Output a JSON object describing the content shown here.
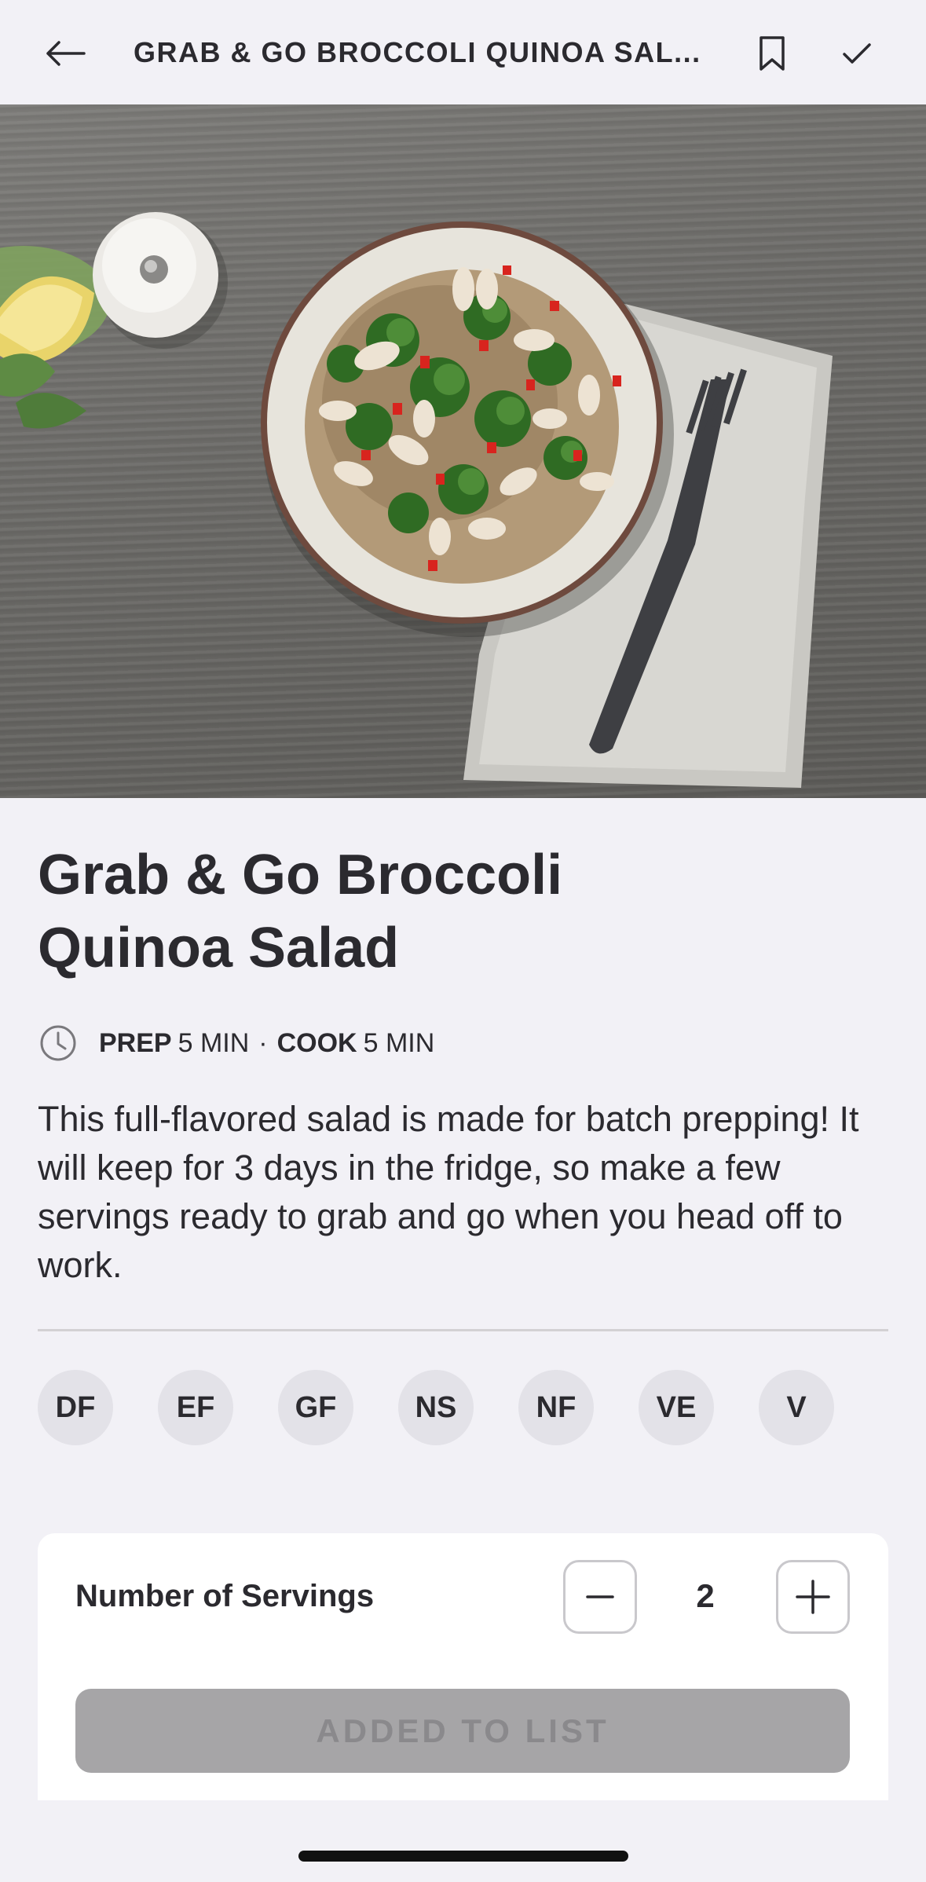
{
  "header": {
    "title": "GRAB & GO BROCCOLI QUINOA SAL..."
  },
  "recipe": {
    "title_line1": "Grab & Go Broccoli",
    "title_line2": "Quinoa Salad",
    "prep_label": "PREP",
    "prep_value": "5 MIN",
    "separator": "·",
    "cook_label": "COOK",
    "cook_value": "5 MIN",
    "description": "This full-flavored salad is made for batch prepping! It will keep for 3 days in the fridge, so make a few servings ready to grab and go when you head off to work."
  },
  "diet_badges": [
    "DF",
    "EF",
    "GF",
    "NS",
    "NF",
    "VE",
    "V"
  ],
  "servings": {
    "label": "Number of Servings",
    "value": "2"
  },
  "action": {
    "label": "ADDED TO LIST"
  },
  "icons": {
    "back": "arrow-left-icon",
    "bookmark": "bookmark-icon",
    "done": "checkmark-icon",
    "time": "clock-icon",
    "decrement": "minus-icon",
    "increment": "plus-icon"
  }
}
